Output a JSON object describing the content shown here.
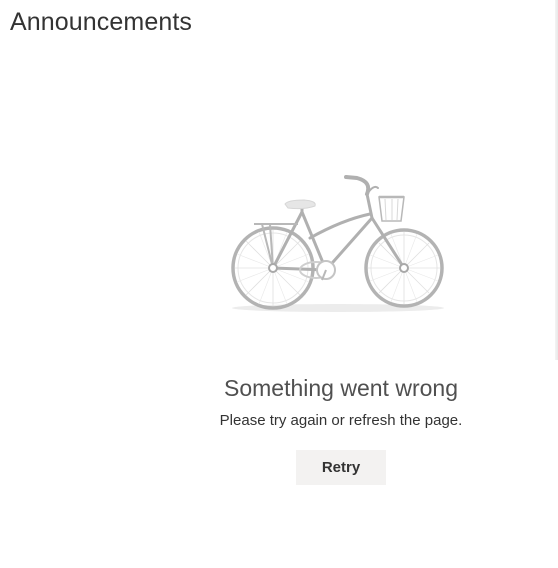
{
  "header": {
    "title": "Announcements"
  },
  "error": {
    "illustration": "bicycle-illustration",
    "heading": "Something went wrong",
    "message": "Please try again or refresh the page.",
    "retry_label": "Retry"
  },
  "colors": {
    "background": "#ffffff",
    "title_text": "#333333",
    "heading_text": "#505050",
    "button_background": "#f3f2f1",
    "illustration_gray": "#b3b3b3"
  }
}
